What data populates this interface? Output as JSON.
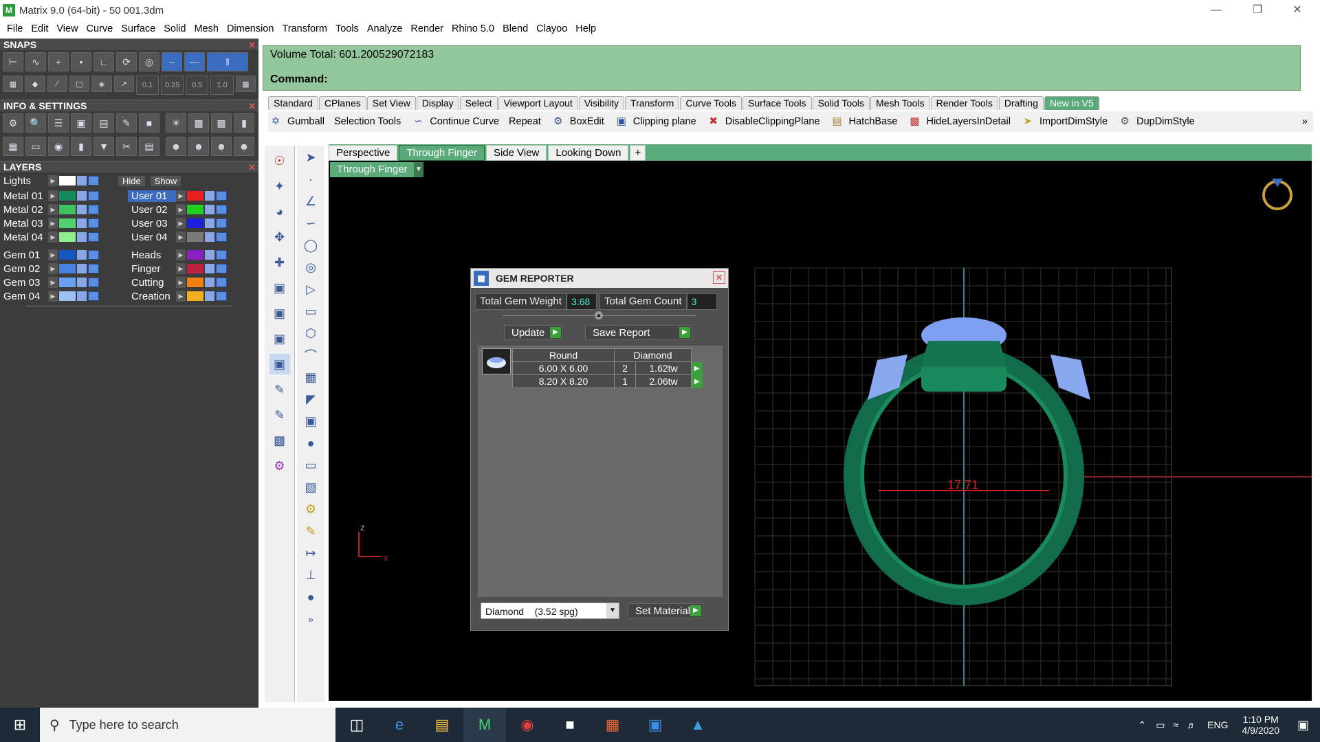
{
  "window": {
    "title": "Matrix 9.0 (64-bit) - 50 001.3dm"
  },
  "menu": [
    "File",
    "Edit",
    "View",
    "Curve",
    "Surface",
    "Solid",
    "Mesh",
    "Dimension",
    "Transform",
    "Tools",
    "Analyze",
    "Render",
    "Rhino 5.0",
    "Blend",
    "Clayoo",
    "Help"
  ],
  "panels": {
    "snaps": "SNAPS",
    "info": "INFO & SETTINGS",
    "layers": "LAYERS"
  },
  "snap_values": [
    "0.1",
    "0.25",
    "0.5",
    "1.0"
  ],
  "layers": {
    "lights": "Lights",
    "hide": "Hide",
    "show": "Show",
    "left": [
      {
        "name": "Metal 01",
        "color": "#138a5a"
      },
      {
        "name": "Metal 02",
        "color": "#3cc060"
      },
      {
        "name": "Metal 03",
        "color": "#52d070"
      },
      {
        "name": "Metal 04",
        "color": "#90ee90"
      },
      {
        "name": "Gem 01",
        "color": "#1656c0"
      },
      {
        "name": "Gem 02",
        "color": "#4a80e0"
      },
      {
        "name": "Gem 03",
        "color": "#6aa0f0"
      },
      {
        "name": "Gem 04",
        "color": "#9ac0f4"
      }
    ],
    "right": [
      {
        "name": "User 01",
        "color": "#e82020"
      },
      {
        "name": "User 02",
        "color": "#20d020"
      },
      {
        "name": "User 03",
        "color": "#2020e0"
      },
      {
        "name": "User 04",
        "color": "#7a7a7a"
      },
      {
        "name": "Heads",
        "color": "#8a20c0"
      },
      {
        "name": "Finger",
        "color": "#c02040"
      },
      {
        "name": "Cutting",
        "color": "#f08010"
      },
      {
        "name": "Creation",
        "color": "#f0b020"
      }
    ]
  },
  "command": {
    "volume": "Volume Total: 601.200529072183",
    "label": "Command:"
  },
  "tabs": [
    "Standard",
    "CPlanes",
    "Set View",
    "Display",
    "Select",
    "Viewport Layout",
    "Visibility",
    "Transform",
    "Curve Tools",
    "Surface Tools",
    "Solid Tools",
    "Mesh Tools",
    "Render Tools",
    "Drafting",
    "New in V5"
  ],
  "toolbar": [
    "Gumball",
    "Selection Tools",
    "Continue Curve",
    "Repeat",
    "BoxEdit",
    "Clipping plane",
    "DisableClippingPlane",
    "HatchBase",
    "HideLayersInDetail",
    "ImportDimStyle",
    "DupDimStyle"
  ],
  "viewport_tabs": [
    "Perspective",
    "Through Finger",
    "Side View",
    "Looking Down"
  ],
  "viewport_label": "Through Finger",
  "dimension": "17.71",
  "axis_label": "z",
  "gem": {
    "title": "GEM REPORTER",
    "weight_label": "Total Gem Weight",
    "weight": "3.68",
    "count_label": "Total Gem Count",
    "count": "3",
    "update": "Update",
    "save": "Save Report",
    "headers": [
      "Round",
      "Diamond"
    ],
    "rows": [
      {
        "size": "6.00 X 6.00",
        "qty": "2",
        "weight": "1.62tw"
      },
      {
        "size": "8.20 X 8.20",
        "qty": "1",
        "weight": "2.06tw"
      }
    ],
    "material": "Diamond    (3.52 spg)",
    "set_material": "Set Material"
  },
  "taskbar": {
    "search": "Type here to search",
    "lang": "ENG",
    "time": "1:10 PM",
    "date": "4/9/2020"
  }
}
